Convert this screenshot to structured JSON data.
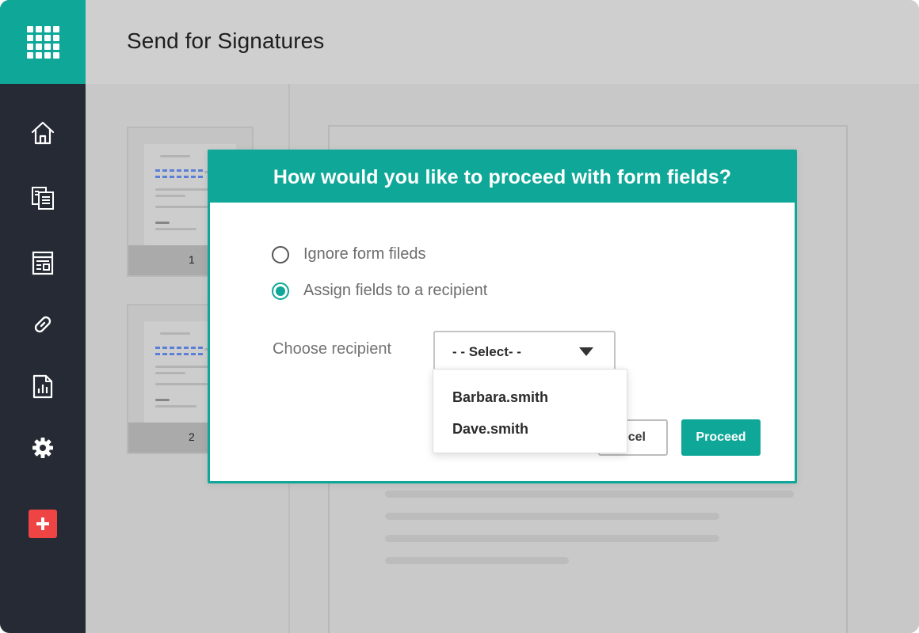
{
  "header": {
    "title": "Send for Signatures"
  },
  "sidebar": {
    "items": [
      {
        "icon": "home-icon"
      },
      {
        "icon": "documents-icon"
      },
      {
        "icon": "templates-icon"
      },
      {
        "icon": "link-icon"
      },
      {
        "icon": "reports-icon"
      },
      {
        "icon": "gear-icon"
      }
    ],
    "add_icon": "plus-icon"
  },
  "thumbnails": [
    {
      "page_number": "1"
    },
    {
      "page_number": "2"
    }
  ],
  "modal": {
    "title": "How would you like to proceed with form fields?",
    "options": [
      {
        "label": "Ignore form fileds",
        "selected": false
      },
      {
        "label": "Assign fields to a recipient",
        "selected": true
      }
    ],
    "recipient_label": "Choose recipient",
    "select_value": "- - Select- -",
    "dropdown_options": [
      "Barbara.smith",
      "Dave.smith"
    ],
    "cancel_label": "ncel",
    "proceed_label": "Proceed"
  },
  "colors": {
    "accent": "#0fa898",
    "sidebar": "#252a35",
    "add_button": "#ef4444"
  }
}
